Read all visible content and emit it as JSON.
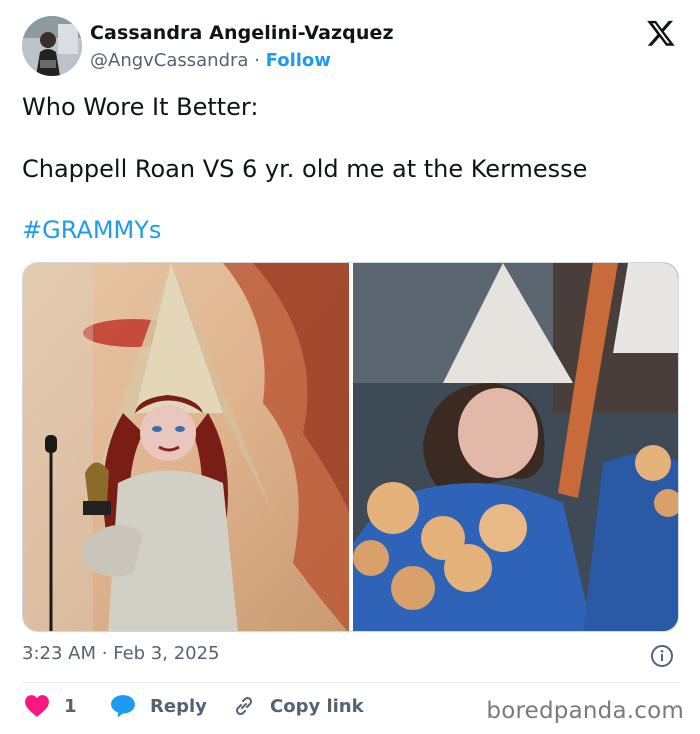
{
  "author": {
    "name": "Cassandra Angelini-Vazquez",
    "handle": "@AngvCassandra",
    "separator": "·",
    "follow_label": "Follow"
  },
  "brand_icon": "x-logo-icon",
  "tweet": {
    "line1": "Who Wore It Better:",
    "line2": "Chappell Roan VS 6 yr. old me at the Kermesse",
    "hashtag": "#GRAMMYs"
  },
  "media": {
    "left_icon": "photo-chappell-roan-grammys",
    "right_icon": "photo-child-kermesse"
  },
  "meta": {
    "time": "3:23 AM",
    "separator": "·",
    "date": "Feb 3, 2025",
    "info_icon": "info-icon"
  },
  "actions": {
    "like_count": "1",
    "reply_label": "Reply",
    "copy_label": "Copy link"
  },
  "watermark": "boredpanda.com",
  "colors": {
    "accent": "#1d9bf0",
    "like": "#f91880",
    "text": "#0f1419",
    "muted": "#536471"
  }
}
